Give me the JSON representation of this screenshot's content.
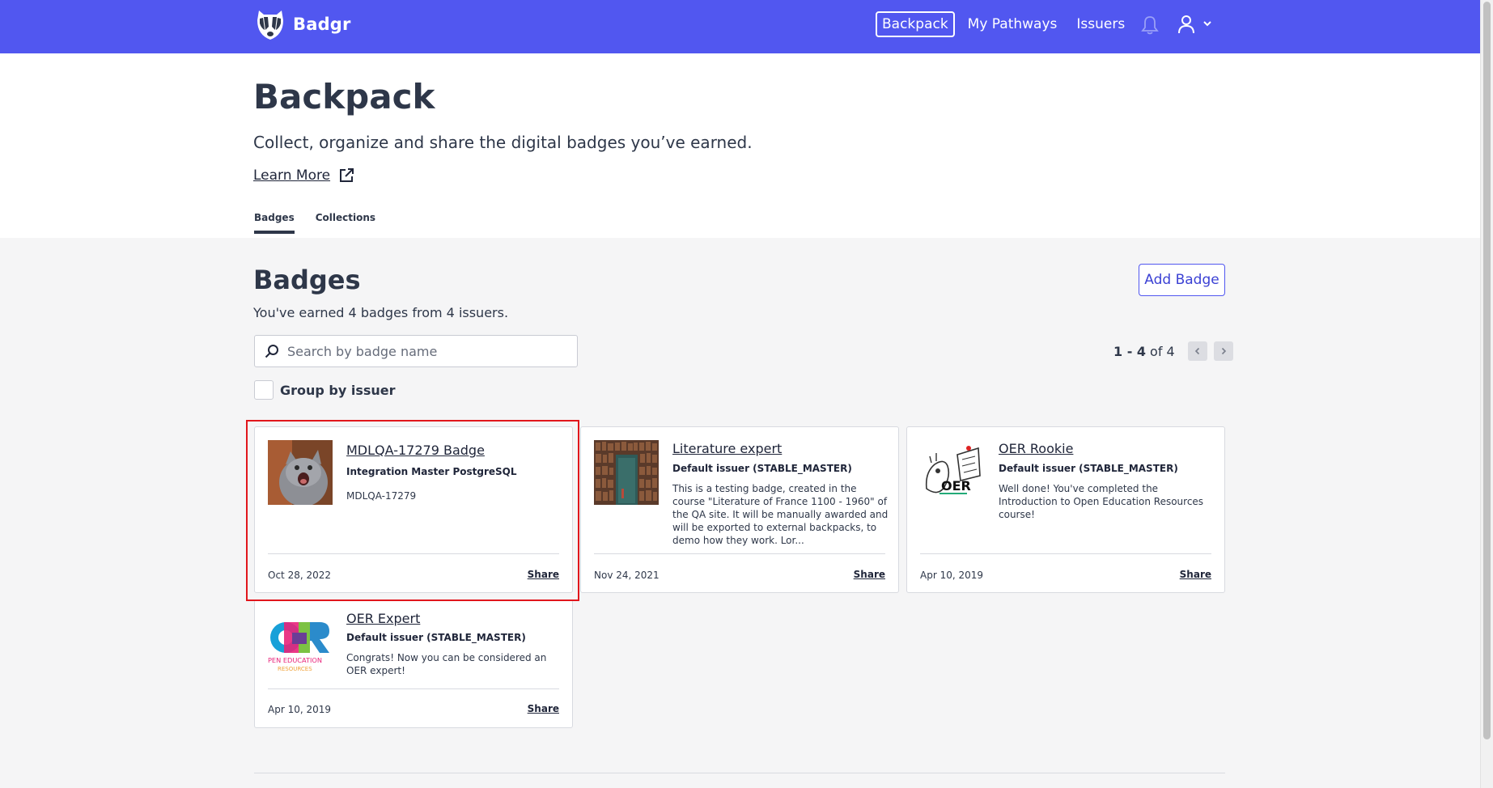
{
  "brand": {
    "name": "Badgr"
  },
  "nav": {
    "backpack": "Backpack",
    "pathways": "My Pathways",
    "issuers": "Issuers"
  },
  "header": {
    "title": "Backpack",
    "subtitle": "Collect, organize and share the digital badges you’ve earned.",
    "learn_more": "Learn More"
  },
  "tabs": [
    {
      "label": "Badges",
      "active": true
    },
    {
      "label": "Collections",
      "active": false
    }
  ],
  "badges_section": {
    "title": "Badges",
    "summary": "You've earned 4 badges from 4 issuers.",
    "add_button": "Add Badge",
    "search_placeholder": "Search by badge name",
    "pager_range": "1 - 4",
    "pager_total": "of 4",
    "group_label": "Group by issuer"
  },
  "cards": [
    {
      "title": "MDLQA-17279 Badge",
      "issuer": "Integration Master PostgreSQL",
      "description": "MDLQA-17279",
      "date": "Oct 28, 2022",
      "share": "Share",
      "image": "cat-photo"
    },
    {
      "title": "Literature expert",
      "issuer": "Default issuer (STABLE_MASTER)",
      "description": "This is a testing badge, created in the course \"Literature of France 1100 - 1960\" of the QA site. It will be manually awarded and will be exported to external backpacks, to demo how they work. Lor...",
      "date": "Nov 24, 2021",
      "share": "Share",
      "image": "bookshelf-door"
    },
    {
      "title": "OER Rookie",
      "issuer": "Default issuer (STABLE_MASTER)",
      "description": "Well done! You've completed the Introduction to Open Education Resources course!",
      "date": "Apr 10, 2019",
      "share": "Share",
      "image": "oer-sketch"
    },
    {
      "title": "OER Expert",
      "issuer": "Default issuer (STABLE_MASTER)",
      "description": "Congrats! Now you can be considered an OER expert!",
      "date": "Apr 10, 2019",
      "share": "Share",
      "image": "oer-logo"
    }
  ],
  "oer_logo_text": {
    "line1": "PEN EDUCATION",
    "line2": "RESOURCES"
  },
  "colors": {
    "nav_bg": "#5157f0",
    "accent": "#3b41d4",
    "highlight": "#e1161c",
    "page_bg": "#f5f5f6"
  }
}
